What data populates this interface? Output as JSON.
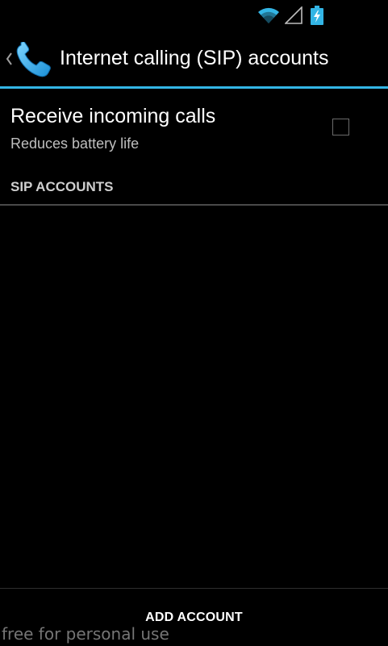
{
  "status_bar": {
    "icons": [
      "wifi-icon",
      "signal-icon",
      "battery-icon"
    ],
    "accent_color": "#33b5e5"
  },
  "action_bar": {
    "title": "Internet calling (SIP) accounts",
    "up_icon": "chevron-left-icon",
    "app_icon": "phone-icon",
    "underline_color": "#33b5e5"
  },
  "preferences": {
    "receive_incoming": {
      "title": "Receive incoming calls",
      "summary": "Reduces battery life",
      "checked": false
    }
  },
  "sip_accounts": {
    "header": "SIP ACCOUNTS",
    "items": []
  },
  "footer": {
    "add_account_label": "ADD ACCOUNT"
  },
  "watermark": "free for personal use"
}
